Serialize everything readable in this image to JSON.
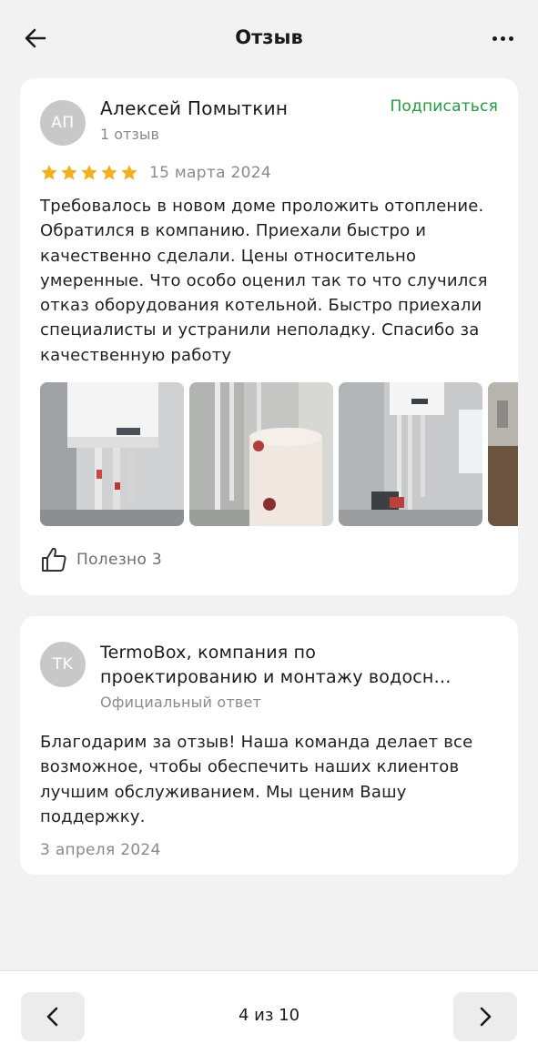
{
  "header": {
    "title": "Отзыв",
    "back_icon": "arrow-left-icon",
    "more_icon": "more-dots-icon"
  },
  "review": {
    "avatar_initials": "АП",
    "author": "Алексей Помыткин",
    "author_reviews": "1 отзыв",
    "subscribe_label": "Подписаться",
    "rating": 5,
    "rating_max": 5,
    "date": "15 марта 2024",
    "text": "Требовалось в новом доме проложить отопление. Обратился в компанию. Приехали быстро и качественно сделали. Цены относительно умеренные. Что особо оценил так то что случился отказ оборудования котельной. Быстро приехали специалисты и устранили неполадку. Спасибо за качественную работу",
    "helpful_label": "Полезно 3",
    "helpful_icon": "thumbs-up-icon"
  },
  "reply": {
    "avatar_initials": "TK",
    "company_line1": "TermoBox, компания по",
    "company_line2": "проектированию и монтажу водосн…",
    "subtitle": "Официальный ответ",
    "text": "Благодарим за отзыв! Наша команда делает все возможное, чтобы обеспечить наших клиентов лучшим обслуживанием. Мы ценим Вашу поддержку.",
    "date": "3 апреля 2024"
  },
  "pager": {
    "label": "4 из 10",
    "prev_icon": "chevron-left-icon",
    "next_icon": "chevron-right-icon"
  },
  "colors": {
    "accent_green": "#1f9e3a",
    "star_gold": "#f6b01e",
    "background": "#f2f2f2",
    "card": "#ffffff",
    "muted_text": "#8a8a8a"
  }
}
